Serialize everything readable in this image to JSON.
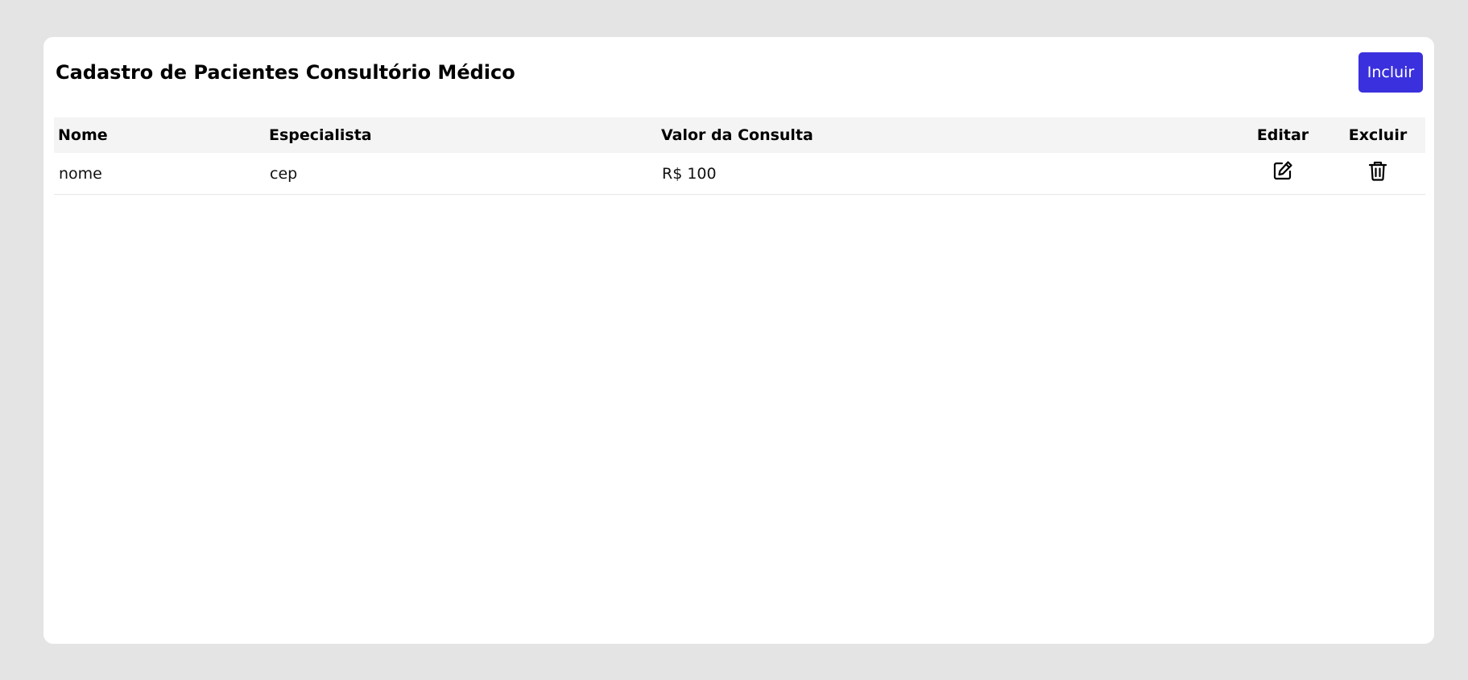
{
  "page": {
    "title": "Cadastro de Pacientes Consultório Médico",
    "add_button_label": "Incluir"
  },
  "colors": {
    "accent": "#3b30dd",
    "background": "#e4e4e4",
    "header_row": "#f4f4f4"
  },
  "table": {
    "columns": [
      "Nome",
      "Especialista",
      "Valor da Consulta",
      "Editar",
      "Excluir"
    ],
    "rows": [
      {
        "nome": "nome",
        "especialista": "cep",
        "valor": "R$ 100",
        "edit_icon": "edit-icon",
        "delete_icon": "trash-icon"
      }
    ]
  }
}
